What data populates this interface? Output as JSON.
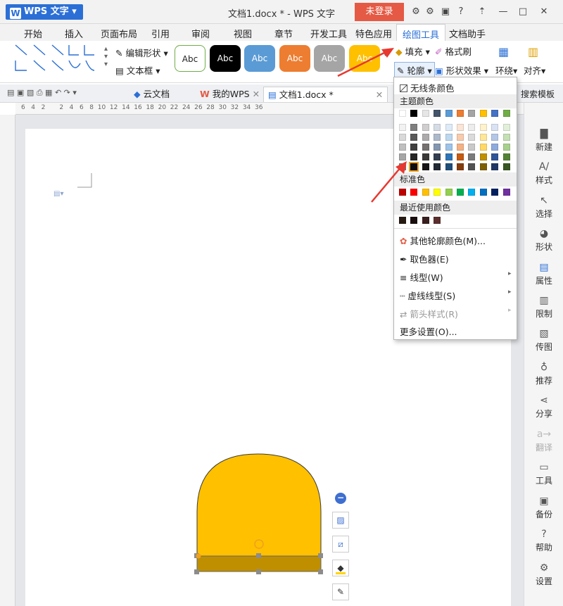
{
  "app": {
    "name": "WPS 文字",
    "logo_letter": "W",
    "document_title": "文档1.docx * - WPS 文字",
    "login": "未登录"
  },
  "menu": [
    "开始",
    "插入",
    "页面布局",
    "引用",
    "审阅",
    "视图",
    "章节",
    "开发工具",
    "特色应用",
    "绘图工具",
    "文档助手"
  ],
  "ribbon": {
    "edit_shape": "编辑形状",
    "text_box": "文本框",
    "style_label": "Abc",
    "fill": "填充",
    "format_brush": "格式刷",
    "outline": "轮廓",
    "shape_effects": "形状效果",
    "wrap": "环绕",
    "align": "对齐"
  },
  "tabs": {
    "cloud": "云文档",
    "mywps": "我的WPS",
    "doc1": "文档1.docx *",
    "search_template": "搜索模板"
  },
  "ruler": "6   4   2       2   4   6   8  10  12  14  16  18  20  22  24  26  28  30  32  34  36",
  "sidebar": [
    "新建",
    "样式",
    "选择",
    "形状",
    "属性",
    "限制",
    "传图",
    "推荐",
    "分享",
    "翻译",
    "工具",
    "备份",
    "帮助",
    "设置"
  ],
  "dropdown": {
    "no_line": "无线条颜色",
    "theme_colors": "主题颜色",
    "standard_colors": "标准色",
    "recent_colors": "最近使用颜色",
    "more_colors": "其他轮廓颜色(M)...",
    "eyedropper": "取色器(E)",
    "line_type": "线型(W)",
    "dash_type": "虚线线型(S)",
    "arrow_style": "箭头样式(R)",
    "more_settings": "更多设置(O)..."
  },
  "colors": {
    "accent": "#2b6fd6",
    "shape_fill": "#ffc000",
    "shape_bottom": "#bf8f00",
    "theme_top": [
      "#ffffff",
      "#000000",
      "#e7e6e6",
      "#44546a",
      "#5b9bd5",
      "#ed7d31",
      "#a5a5a5",
      "#ffc000",
      "#4472c4",
      "#70ad47"
    ],
    "theme_shades": [
      [
        "#f2f2f2",
        "#7f7f7f",
        "#d0cece",
        "#d6dce5",
        "#deebf7",
        "#fbe5d6",
        "#ededed",
        "#fff2cc",
        "#dae3f3",
        "#e2f0d9"
      ],
      [
        "#d9d9d9",
        "#595959",
        "#aeabab",
        "#adb9ca",
        "#bdd7ee",
        "#f8cbad",
        "#dbdbdb",
        "#ffe699",
        "#b4c7e7",
        "#c5e0b4"
      ],
      [
        "#bfbfbf",
        "#404040",
        "#767171",
        "#8497b0",
        "#9dc3e6",
        "#f4b183",
        "#c9c9c9",
        "#ffd966",
        "#8faadc",
        "#a9d18e"
      ],
      [
        "#a6a6a6",
        "#262626",
        "#3b3838",
        "#333f50",
        "#2e75b6",
        "#c55a11",
        "#7b7b7b",
        "#bf9000",
        "#2f5597",
        "#548235"
      ],
      [
        "#808080",
        "#0d0d0d",
        "#171515",
        "#222a35",
        "#1f4e79",
        "#843c0c",
        "#525252",
        "#7f6000",
        "#203864",
        "#385723"
      ]
    ],
    "standard": [
      "#c00000",
      "#ff0000",
      "#ffc000",
      "#ffff00",
      "#92d050",
      "#00b050",
      "#00b0f0",
      "#0070c0",
      "#002060",
      "#7030a0"
    ],
    "recent": [
      "#261a12",
      "#1a0d0d",
      "#3a1f1f",
      "#5c2e2e"
    ],
    "annotation_arrow": "#e8382f"
  }
}
